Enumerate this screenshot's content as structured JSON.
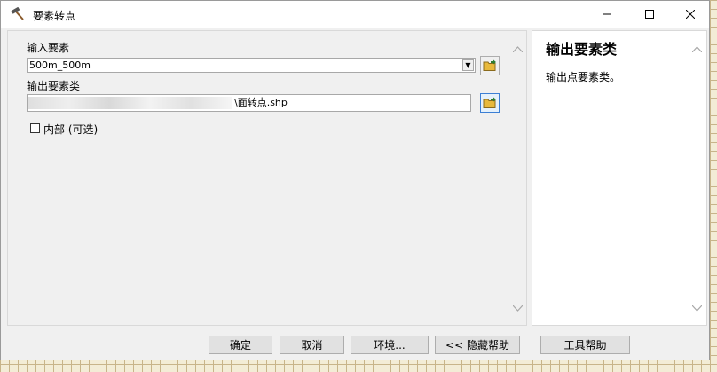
{
  "window": {
    "title": "要素转点",
    "title_icon": "hammer-icon",
    "controls": {
      "minimize": "minimize-icon",
      "maximize": "maximize-icon",
      "close": "close-icon"
    }
  },
  "form": {
    "input_label": "输入要素",
    "input_value": "500m_500m",
    "output_label": "输出要素类",
    "output_value": "\\面转点.shp",
    "checkbox_label": "内部 (可选)",
    "checkbox_checked": false
  },
  "help": {
    "title": "输出要素类",
    "text": "输出点要素类。"
  },
  "buttons": {
    "ok": "确定",
    "cancel": "取消",
    "environments": "环境...",
    "hide_help": "<< 隐藏帮助",
    "tool_help": "工具帮助"
  },
  "colors": {
    "accent": "#3c7fd4",
    "window_bg": "#f0f0f0",
    "folder": "#e8b93c"
  }
}
